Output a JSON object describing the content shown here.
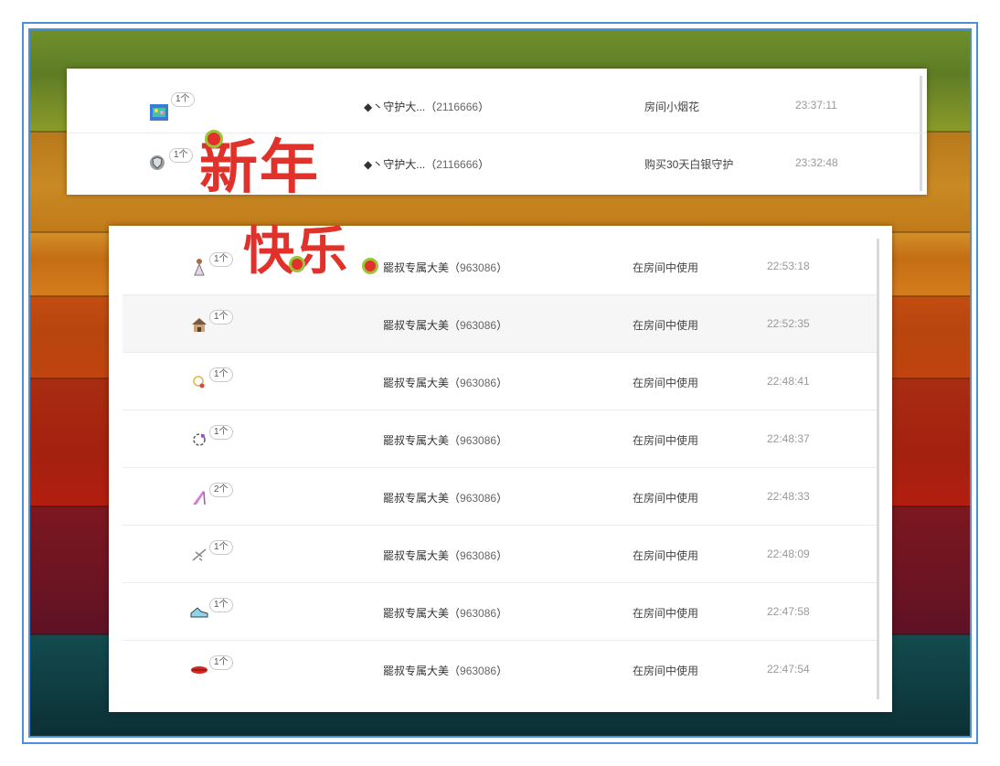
{
  "top_list": {
    "rows": [
      {
        "icon": "fireworks-icon",
        "count": "1个",
        "user": "◆丶守护大...",
        "user_id": "2116666",
        "reason": "房间小烟花",
        "time": "23:37:11"
      },
      {
        "icon": "silver-shield-icon",
        "count": "1个",
        "user": "◆丶守护大...",
        "user_id": "2116666",
        "reason": "购买30天白银守护",
        "time": "23:32:48"
      }
    ]
  },
  "main_list": {
    "rows": [
      {
        "icon": "doll-icon",
        "count": "1个",
        "user": "罷叔专属大美",
        "user_id": "963086",
        "reason": "在房间中使用",
        "time": "22:53:18"
      },
      {
        "icon": "house-icon",
        "count": "1个",
        "user": "罷叔专属大美",
        "user_id": "963086",
        "reason": "在房间中使用",
        "time": "22:52:35"
      },
      {
        "icon": "ring-icon",
        "count": "1个",
        "user": "罷叔专属大美",
        "user_id": "963086",
        "reason": "在房间中使用",
        "time": "22:48:41"
      },
      {
        "icon": "bracelet-icon",
        "count": "1个",
        "user": "罷叔专属大美",
        "user_id": "963086",
        "reason": "在房间中使用",
        "time": "22:48:37"
      },
      {
        "icon": "high-heel-icon",
        "count": "2个",
        "user": "罷叔专属大美",
        "user_id": "963086",
        "reason": "在房间中使用",
        "time": "22:48:33"
      },
      {
        "icon": "airplane-icon",
        "count": "1个",
        "user": "罷叔专属大美",
        "user_id": "963086",
        "reason": "在房间中使用",
        "time": "22:48:09"
      },
      {
        "icon": "sneaker-icon",
        "count": "1个",
        "user": "罷叔专属大美",
        "user_id": "963086",
        "reason": "在房间中使用",
        "time": "22:47:58"
      },
      {
        "icon": "lips-icon",
        "count": "1个",
        "user": "罷叔专属大美",
        "user_id": "963086",
        "reason": "在房间中使用",
        "time": "22:47:54"
      }
    ]
  },
  "greeting": {
    "line1": "新年",
    "line2": "快乐"
  },
  "colors": {
    "frame_border": "#4a90d9",
    "greeting_red": "#e0312b",
    "greeting_green": "#9cc43a"
  }
}
